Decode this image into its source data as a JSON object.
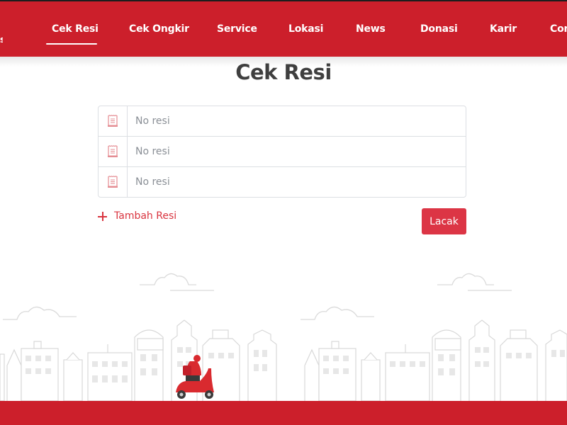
{
  "navbar": {
    "logo_fragment": "s",
    "active_index": 0,
    "items": [
      {
        "label": "Cek Resi"
      },
      {
        "label": "Cek Ongkir"
      },
      {
        "label": "Service"
      },
      {
        "label": "Lokasi"
      },
      {
        "label": "News"
      },
      {
        "label": "Donasi"
      },
      {
        "label": "Karir"
      },
      {
        "label": "Con"
      }
    ]
  },
  "page": {
    "title": "Cek Resi"
  },
  "form": {
    "rows": [
      {
        "icon": "receipt-icon",
        "value": "",
        "placeholder": "No resi"
      },
      {
        "icon": "receipt-icon",
        "value": "",
        "placeholder": "No resi"
      },
      {
        "icon": "receipt-icon",
        "value": "",
        "placeholder": "No resi"
      }
    ],
    "add_label": "Tambah Resi",
    "add_icon": "plus-icon",
    "submit_label": "Lacak"
  },
  "illustration": {
    "scene": "city-skyline-outline",
    "courier": "scooter-courier"
  },
  "colors": {
    "brand_red": "#cc1f2b",
    "button_red": "#dc3545",
    "link_red": "#d9343f",
    "title_text": "#3f3f3f"
  }
}
